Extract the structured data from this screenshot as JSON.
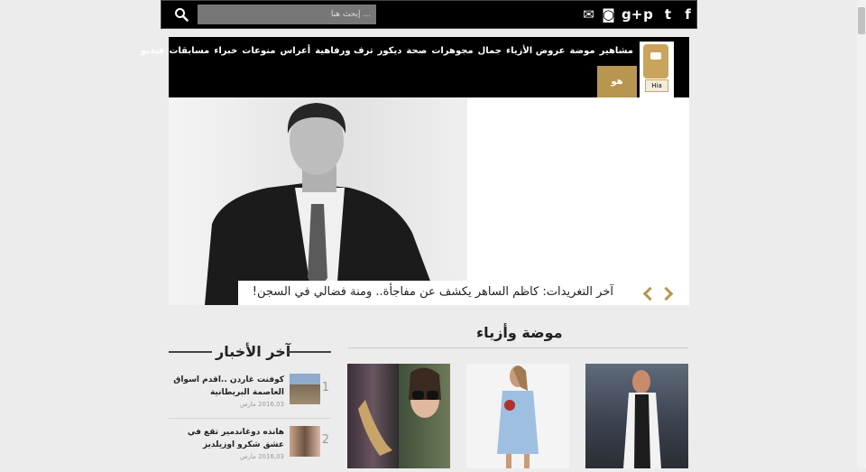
{
  "topbar": {
    "social": [
      {
        "icon": "facebook-icon",
        "glyph": "f"
      },
      {
        "icon": "twitter-icon",
        "glyph": "t"
      },
      {
        "icon": "pinterest-icon",
        "glyph": "p"
      },
      {
        "icon": "google-plus-icon",
        "glyph": "g+"
      },
      {
        "icon": "instagram-icon",
        "glyph": "◙"
      },
      {
        "icon": "email-icon",
        "glyph": "✉"
      }
    ],
    "search_placeholder": "إبحث هنا ..."
  },
  "nav": {
    "items": [
      "مشاهير",
      "موضة",
      "عروض الأزياء",
      "جمال",
      "مجوهرات",
      "صحة",
      "ديكور",
      "ترف ورفاهية",
      "أعراس",
      "منوعات",
      "خبراء",
      "مسابقات",
      "فيديو"
    ],
    "gold_tab": "هو"
  },
  "logo": {
    "badge": "Hia"
  },
  "hero": {
    "caption": "آخر التغريدات: كاظم الساهر يكشف عن مفاجأة.. ومنة فضالي في السجن!"
  },
  "sections": {
    "fashion_title": "موضة وأزياء",
    "news_title": "آخر الأخبار"
  },
  "news": [
    {
      "num": "1",
      "text": "كوفنت غاردن ..اقدم اسواق العاصمة البريطانية",
      "date": "2016,03 مارس"
    },
    {
      "num": "2",
      "text": "هانده دوغاندمير تقع في عشق شكرو اوزيلديز",
      "date": "2016,03 مارس"
    }
  ],
  "colors": {
    "accent": "#b8964f",
    "header": "#000000"
  }
}
